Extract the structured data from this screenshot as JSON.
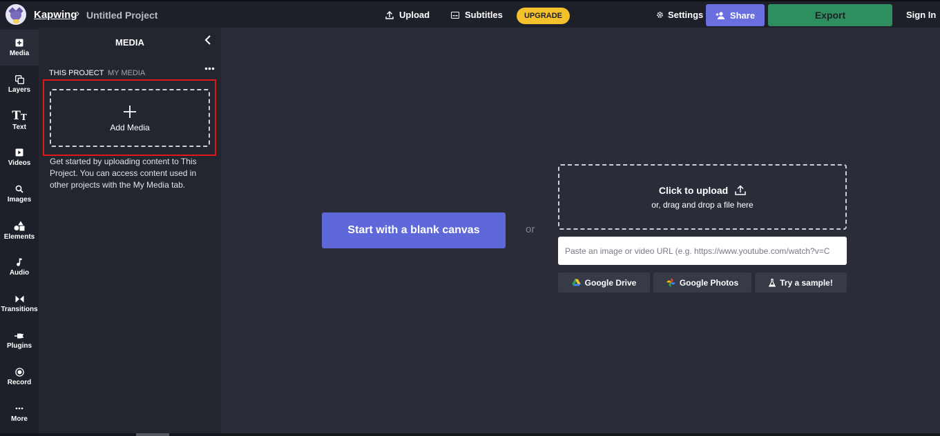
{
  "header": {
    "brand": "Kapwing",
    "separator": "›",
    "project_title": "Untitled Project",
    "upload_label": "Upload",
    "subtitles_label": "Subtitles",
    "upgrade_label": "UPGRADE",
    "settings_label": "Settings",
    "share_label": "Share",
    "export_label": "Export",
    "signin_label": "Sign In"
  },
  "sidebar": {
    "items": [
      {
        "label": "Media",
        "icon": "media-icon"
      },
      {
        "label": "Layers",
        "icon": "layers-icon"
      },
      {
        "label": "Text",
        "icon": "text-icon"
      },
      {
        "label": "Videos",
        "icon": "videos-icon"
      },
      {
        "label": "Images",
        "icon": "images-icon"
      },
      {
        "label": "Elements",
        "icon": "elements-icon"
      },
      {
        "label": "Audio",
        "icon": "audio-icon"
      },
      {
        "label": "Transitions",
        "icon": "transitions-icon"
      },
      {
        "label": "Plugins",
        "icon": "plugins-icon"
      },
      {
        "label": "Record",
        "icon": "record-icon"
      },
      {
        "label": "More",
        "icon": "more-icon"
      }
    ]
  },
  "media_panel": {
    "title": "MEDIA",
    "tabs": [
      "THIS PROJECT",
      "MY MEDIA"
    ],
    "add_media_label": "Add Media",
    "help_text": "Get started by uploading content to This Project. You can access content used in other projects with the My Media tab."
  },
  "canvas": {
    "blank_canvas_label": "Start with a blank canvas",
    "or_label": "or",
    "upload_title": "Click to upload",
    "upload_subtitle": "or, drag and drop a file here",
    "url_placeholder": "Paste an image or video URL (e.g. https://www.youtube.com/watch?v=C",
    "sources": [
      "Google Drive",
      "Google Photos",
      "Try a sample!"
    ]
  },
  "colors": {
    "accent": "#5e68d8",
    "export": "#2f8e5f",
    "upgrade": "#f4c12c",
    "highlight": "#e0171b"
  }
}
